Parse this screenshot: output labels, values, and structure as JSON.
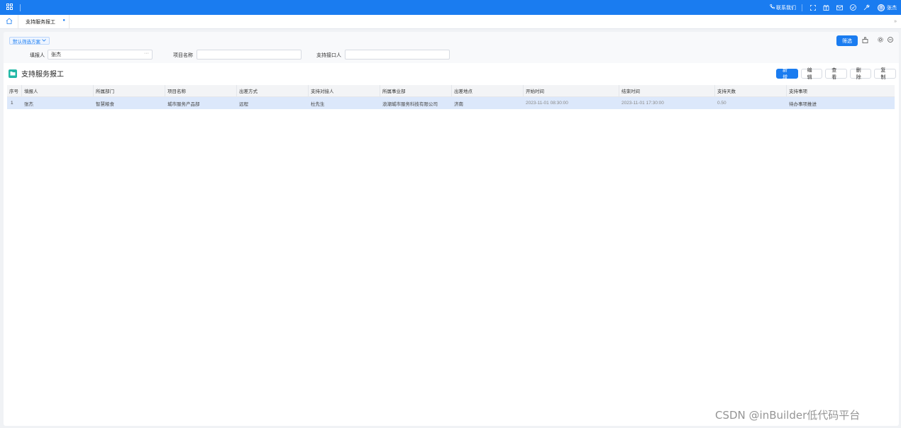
{
  "topbar": {
    "contact": "联系我们",
    "user": "张杰",
    "avatar_text": "张"
  },
  "tabs": [
    {
      "label": "支持服务报工"
    }
  ],
  "filter": {
    "scheme_label": "默认筛选方案",
    "reporter_label": "填报人",
    "reporter_value": "张杰",
    "project_label": "项目名称",
    "project_value": "",
    "contact_label": "支持接口人",
    "contact_value": "",
    "filter_button": "筛选"
  },
  "page": {
    "title": "支持服务报工"
  },
  "actions": [
    "新增",
    "编辑",
    "查看",
    "删除",
    "复制"
  ],
  "table": {
    "columns": [
      "序号",
      "填报人",
      "所属部门",
      "项目名称",
      "出差方式",
      "支持对接人",
      "所属事业部",
      "出差地点",
      "开始时间",
      "结束时间",
      "支持天数",
      "支持事项"
    ],
    "rows": [
      [
        "1",
        "张杰",
        "智慧粮食",
        "城市服务产品部",
        "远程",
        "杜先生",
        "浪潮城市服务科技有限公司",
        "济南",
        "2023-11-01 08:30:00",
        "2023-11-01 17:30:00",
        "0.50",
        "待办事项推进"
      ]
    ]
  },
  "watermark": "CSDN @inBuilder低代码平台",
  "colors": {
    "primary": "#1a7cf0",
    "title_icon": "#22b8a6",
    "row_selected": "#dce8fb"
  }
}
